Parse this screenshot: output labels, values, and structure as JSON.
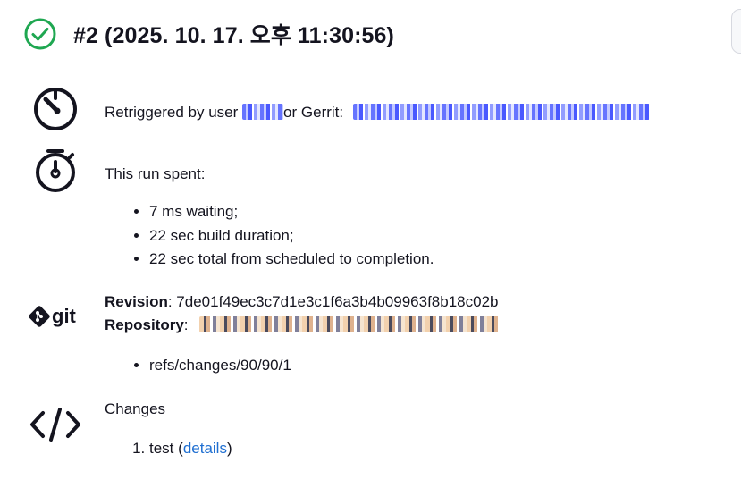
{
  "header": {
    "title": "#2 (2025. 10. 17. 오후 11:30:56)",
    "status": "success",
    "status_color": "#1fa751"
  },
  "cause": {
    "prefix": "Retriggered by user",
    "middle": "or Gerrit:"
  },
  "timing": {
    "heading": "This run spent:",
    "items": [
      "7 ms waiting;",
      "22 sec build duration;",
      "22 sec total from scheduled to completion."
    ]
  },
  "git": {
    "logo_text": "git",
    "revision_label": "Revision",
    "revision_value": ": 7de01f49ec3c7d1e3c1f6a3b4b09963f8b18c02b",
    "repository_label": "Repository",
    "repository_sep": ":",
    "refs": [
      "refs/changes/90/90/1"
    ]
  },
  "changes": {
    "heading": "Changes",
    "items": [
      {
        "text": "test",
        "open": "(",
        "link": "details",
        "close": ")"
      }
    ]
  },
  "icons": {
    "status": "check-circle-icon",
    "cause": "timer-icon",
    "timing": "stopwatch-icon",
    "scm": "git-logo-icon",
    "changes": "code-icon"
  }
}
